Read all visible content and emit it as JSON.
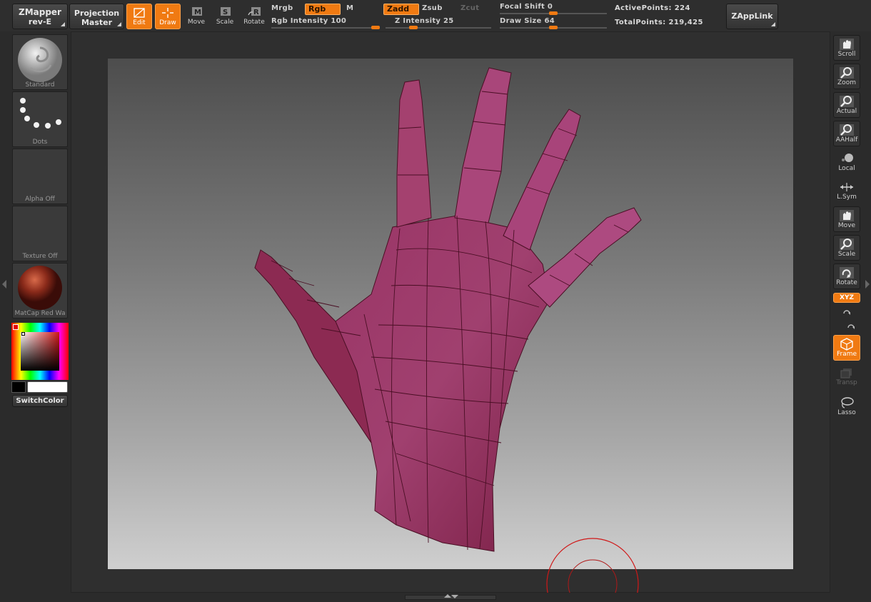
{
  "menu": {
    "zmapper": {
      "line1": "ZMapper",
      "line2": "rev-E"
    },
    "projection": {
      "line1": "Projection",
      "line2": "Master"
    },
    "zapplink": "ZAppLink"
  },
  "tools": [
    {
      "name": "edit",
      "label": "Edit",
      "active": true
    },
    {
      "name": "draw",
      "label": "Draw",
      "active": true
    },
    {
      "name": "move",
      "label": "Move",
      "active": false
    },
    {
      "name": "scale",
      "label": "Scale",
      "active": false
    },
    {
      "name": "rotate",
      "label": "Rotate",
      "active": false
    }
  ],
  "color_mode": {
    "mrgb": "Mrgb",
    "rgb": "Rgb",
    "m": "M",
    "rgb_intensity_label": "Rgb  Intensity",
    "rgb_intensity": "100"
  },
  "z_mode": {
    "zadd": "Zadd",
    "zsub": "Zsub",
    "zcut": "Zcut",
    "z_intensity_label": "Z  Intensity",
    "z_intensity": "25"
  },
  "brush_params": {
    "focal_shift_label": "Focal  Shift",
    "focal_shift": "0",
    "draw_size_label": "Draw  Size",
    "draw_size": "64"
  },
  "stats": {
    "active_points_label": "ActivePoints:",
    "active_points": "224",
    "total_points_label": "TotalPoints:",
    "total_points": "219,425"
  },
  "left_shelf": {
    "brush": "Standard",
    "stroke": "Dots",
    "alpha": "Alpha  Off",
    "texture": "Texture  Off",
    "material": "MatCap  Red  Wa",
    "switch_color": "SwitchColor"
  },
  "right_shelf": [
    {
      "id": "scroll",
      "label": "Scroll"
    },
    {
      "id": "zoom",
      "label": "Zoom"
    },
    {
      "id": "actual",
      "label": "Actual"
    },
    {
      "id": "aahalf",
      "label": "AAHalf"
    },
    {
      "id": "local",
      "label": "Local"
    },
    {
      "id": "lsym",
      "label": "L.Sym"
    },
    {
      "id": "move",
      "label": "Move"
    },
    {
      "id": "scale",
      "label": "Scale"
    },
    {
      "id": "rotate",
      "label": "Rotate"
    },
    {
      "id": "xyz",
      "label": "XYZ"
    },
    {
      "id": "frame",
      "label": "Frame"
    },
    {
      "id": "transp",
      "label": "Transp"
    },
    {
      "id": "lasso",
      "label": "Lasso"
    }
  ],
  "colors": {
    "accent": "#f07a12",
    "mesh": "#8e2a55",
    "mesh_dark": "#5a1428",
    "cursor": "#e01818"
  }
}
